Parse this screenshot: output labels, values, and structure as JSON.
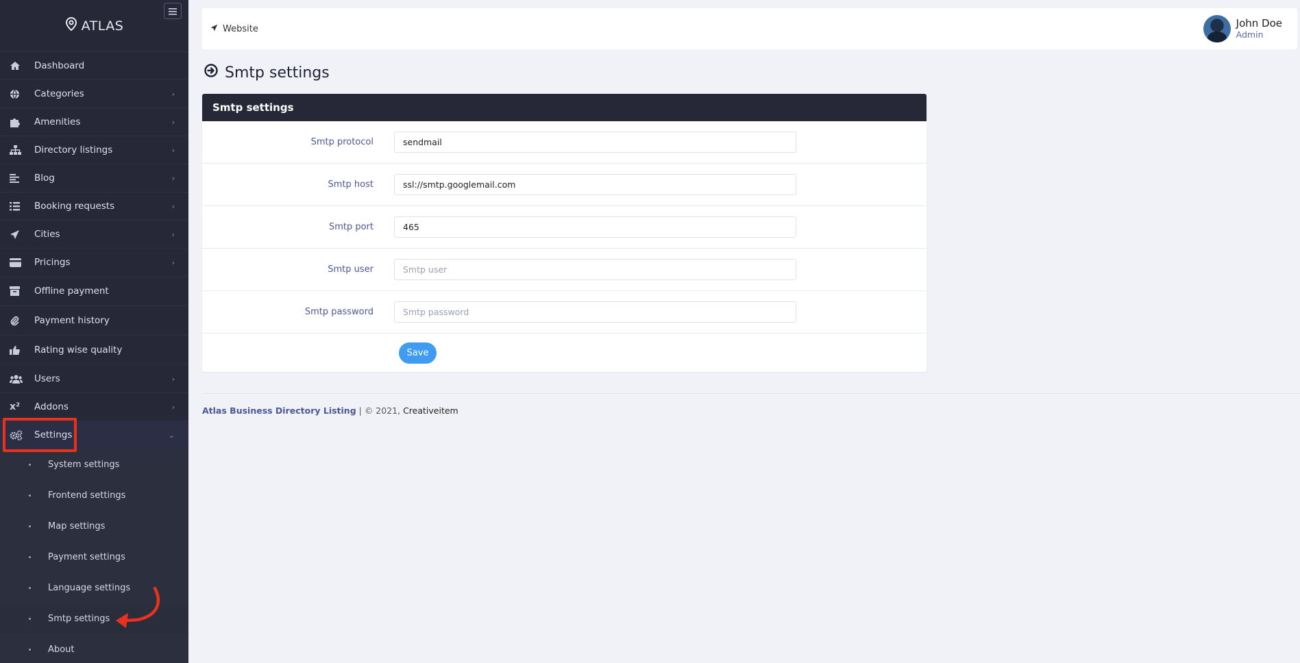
{
  "sidebar": {
    "brand": "ATLAS",
    "items": [
      {
        "label": "Dashboard",
        "icon": "home-icon",
        "chevron": false
      },
      {
        "label": "Categories",
        "icon": "globe-icon",
        "chevron": true
      },
      {
        "label": "Amenities",
        "icon": "puzzle-icon",
        "chevron": true
      },
      {
        "label": "Directory listings",
        "icon": "sitemap-icon",
        "chevron": true
      },
      {
        "label": "Blog",
        "icon": "align-left-icon",
        "chevron": true
      },
      {
        "label": "Booking requests",
        "icon": "tasks-icon",
        "chevron": true
      },
      {
        "label": "Cities",
        "icon": "paper-plane-icon",
        "chevron": true
      },
      {
        "label": "Pricings",
        "icon": "credit-card-icon",
        "chevron": true
      },
      {
        "label": "Offline payment",
        "icon": "archive-icon",
        "chevron": false
      },
      {
        "label": "Payment history",
        "icon": "paperclip-icon",
        "chevron": false
      },
      {
        "label": "Rating wise quality",
        "icon": "thumbs-up-icon",
        "chevron": false
      },
      {
        "label": "Users",
        "icon": "users-icon",
        "chevron": true
      },
      {
        "label": "Addons",
        "icon": "superscript-icon",
        "chevron": true
      },
      {
        "label": "Settings",
        "icon": "cogs-icon",
        "chevron": true
      }
    ],
    "settings_sub": [
      {
        "label": "System settings"
      },
      {
        "label": "Frontend settings"
      },
      {
        "label": "Map settings"
      },
      {
        "label": "Payment settings"
      },
      {
        "label": "Language settings"
      },
      {
        "label": "Smtp settings"
      },
      {
        "label": "About"
      }
    ]
  },
  "topbar": {
    "website_label": "Website",
    "user_name": "John Doe",
    "user_role": "Admin"
  },
  "page": {
    "title": "Smtp settings"
  },
  "card": {
    "header": "Smtp settings",
    "fields": [
      {
        "label": "Smtp protocol",
        "value": "sendmail",
        "placeholder": ""
      },
      {
        "label": "Smtp host",
        "value": "ssl://smtp.googlemail.com",
        "placeholder": ""
      },
      {
        "label": "Smtp port",
        "value": "465",
        "placeholder": ""
      },
      {
        "label": "Smtp user",
        "value": "",
        "placeholder": "Smtp user"
      },
      {
        "label": "Smtp password",
        "value": "",
        "placeholder": "Smtp password"
      }
    ],
    "save_label": "Save"
  },
  "footer": {
    "brand": "Atlas Business Directory Listing",
    "copyright": " | © 2021, ",
    "company": "Creativeitem"
  },
  "colors": {
    "sidebar_bg": "#262837",
    "accent_blue": "#3f9cf0",
    "label_blue": "#4b5896",
    "highlight_red": "#e8321e"
  }
}
